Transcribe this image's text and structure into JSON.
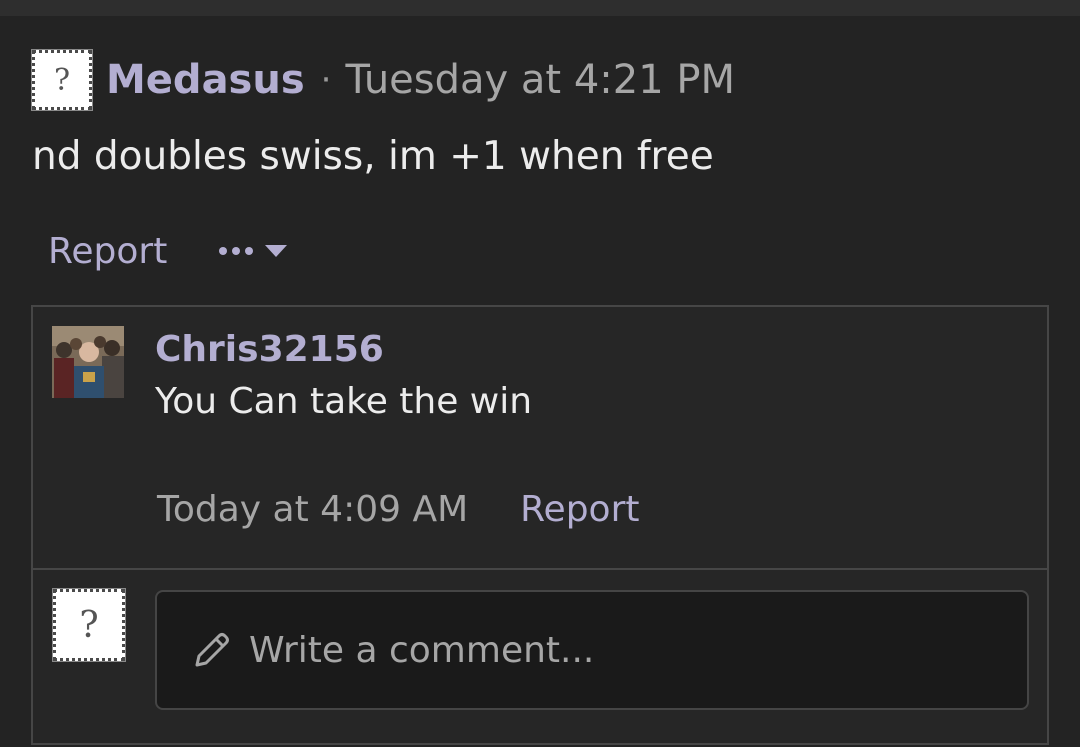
{
  "post": {
    "author": "Medasus",
    "separator": "·",
    "timestamp": "Tuesday at 4:21 PM",
    "body": "nd doubles swiss, im +1 when free",
    "report_label": "Report",
    "avatar_placeholder": "?",
    "more_icon": "ellipsis-caret-icon"
  },
  "reply": {
    "author": "Chris32156",
    "text": "You Can take the win",
    "timestamp": "Today at 4:09 AM",
    "report_label": "Report"
  },
  "comment_box": {
    "placeholder": "Write a comment...",
    "avatar_placeholder": "?",
    "icon": "pencil-icon"
  },
  "colors": {
    "background": "#232323",
    "accent_link": "#b3aed1",
    "text_primary": "#ececec",
    "text_muted": "#a6a6a6"
  }
}
